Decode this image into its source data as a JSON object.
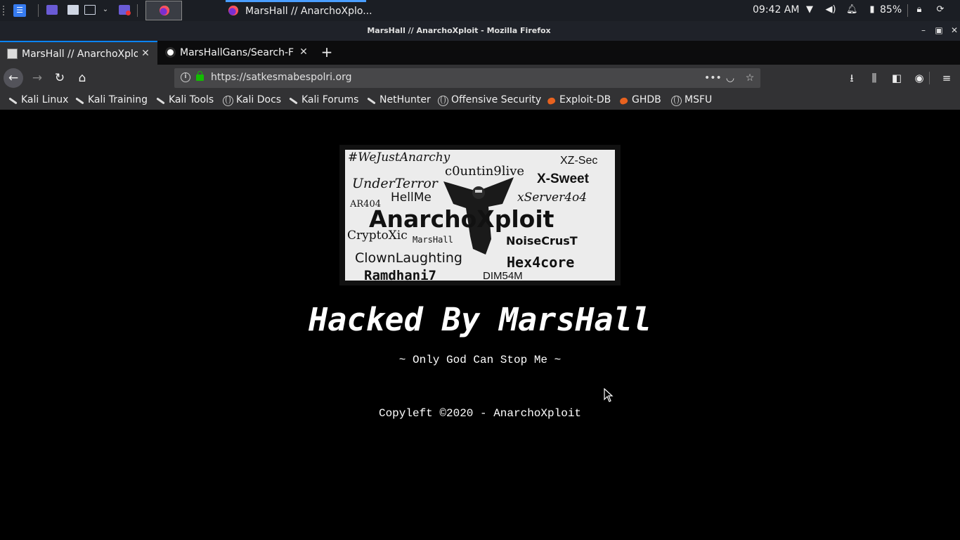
{
  "taskbar": {
    "task_title": "MarsHall // AnarchoXplo...",
    "clock": "09:42 AM",
    "battery": "85%"
  },
  "window": {
    "title": "MarsHall // AnarchoXploit - Mozilla Firefox"
  },
  "tabs": [
    {
      "label": "MarsHall // AnarchoXploi",
      "active": true
    },
    {
      "label": "MarsHallGans/Search-F",
      "active": false
    }
  ],
  "urlbar": {
    "url": "https://satkesmabespolri.org"
  },
  "bookmarks": [
    {
      "label": "Kali Linux",
      "icon": "kali-dragon-icon"
    },
    {
      "label": "Kali Training",
      "icon": "kali-dragon-icon"
    },
    {
      "label": "Kali Tools",
      "icon": "kali-dragon-icon"
    },
    {
      "label": "Kali Docs",
      "icon": "globe-icon"
    },
    {
      "label": "Kali Forums",
      "icon": "kali-dragon-icon"
    },
    {
      "label": "NetHunter",
      "icon": "kali-dragon-icon"
    },
    {
      "label": "Offensive Security",
      "icon": "globe-icon"
    },
    {
      "label": "Exploit-DB",
      "icon": "exploit-db-icon"
    },
    {
      "label": "GHDB",
      "icon": "exploit-db-icon"
    },
    {
      "label": "MSFU",
      "icon": "globe-icon"
    }
  ],
  "page": {
    "banner_words": {
      "w1": "#WeJustAnarchy",
      "w2": "XZ-Sec",
      "w3": "c0untin9live",
      "w4": "X-Sweet",
      "w5": "UnderTerror",
      "w6": "HellMe",
      "w7": "xServer4o4",
      "w8": "AR404",
      "w9": "AnarchoXploit",
      "w10": "CryptoXic",
      "w11": "MarsHall",
      "w12": "NoiseCrusT",
      "w13": "ClownLaughting",
      "w14": "Hex4core",
      "w15": "Ramdhani7",
      "w16": "DIM54M"
    },
    "headline": "Hacked By MarsHall",
    "tagline": "~ Only God Can Stop Me ~",
    "footer": "Copyleft ©2020 - AnarchoXploit"
  },
  "colors": {
    "accent": "#0a84ff",
    "lock": "#12bc00",
    "page_bg": "#000000"
  }
}
